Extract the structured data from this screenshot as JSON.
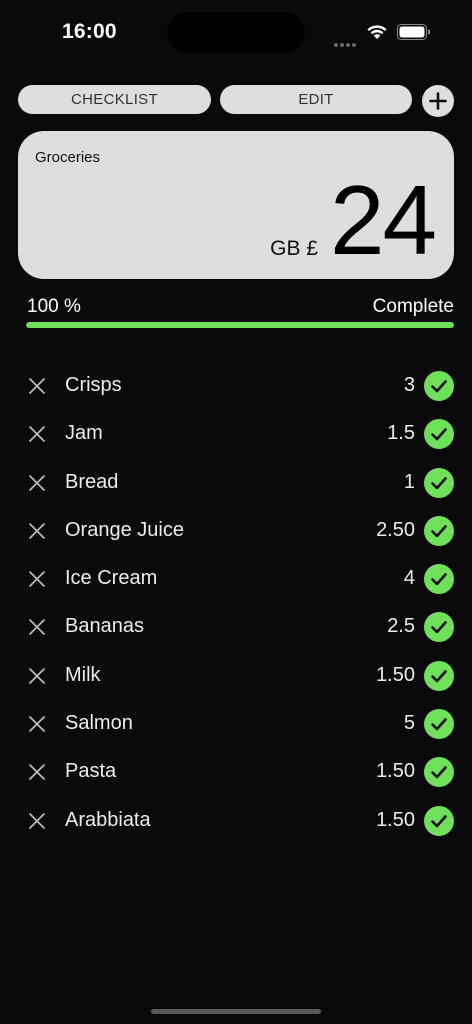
{
  "status_bar": {
    "time": "16:00",
    "icons": [
      "cellular-signal-icon",
      "wifi-icon",
      "battery-icon"
    ]
  },
  "toolbar": {
    "checklist_label": "CHECKLIST",
    "edit_label": "EDIT",
    "add_icon": "plus-icon"
  },
  "summary": {
    "list_name": "Groceries",
    "currency": "GB £",
    "total": "24"
  },
  "progress": {
    "percent_label": "100 %",
    "status": "Complete",
    "fraction": 1.0
  },
  "items": [
    {
      "name": "Crisps",
      "price": "3",
      "checked": true
    },
    {
      "name": "Jam",
      "price": "1.5",
      "checked": true
    },
    {
      "name": "Bread",
      "price": "1",
      "checked": true
    },
    {
      "name": "Orange Juice",
      "price": "2.50",
      "checked": true
    },
    {
      "name": "Ice Cream",
      "price": "4",
      "checked": true
    },
    {
      "name": "Bananas",
      "price": "2.5",
      "checked": true
    },
    {
      "name": "Milk",
      "price": "1.50",
      "checked": true
    },
    {
      "name": "Salmon",
      "price": "5",
      "checked": true
    },
    {
      "name": "Pasta",
      "price": "1.50",
      "checked": true
    },
    {
      "name": "Arabbiata",
      "price": "1.50",
      "checked": true
    }
  ],
  "colors": {
    "background": "#0a0a0a",
    "card": "#dedede",
    "accent_green": "#6fe05a",
    "text": "#ededed"
  }
}
